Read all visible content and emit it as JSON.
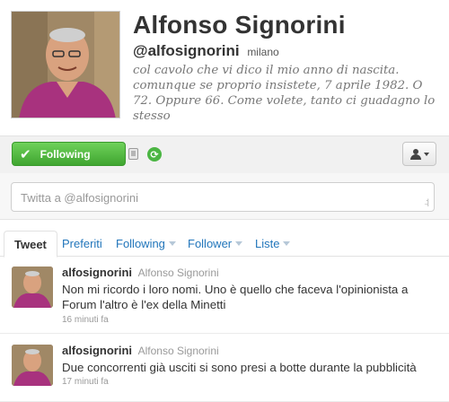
{
  "profile": {
    "display_name": "Alfonso Signorini",
    "screen_name": "@alfosignorini",
    "location": "milano",
    "bio": "col cavolo che vi dico il mio anno di nascita. comunque se proprio insistete, 7 aprile 1982. O 72. Oppure 66. Come volete, tanto ci guadagno lo stesso",
    "avatar_icon": "profile-photo"
  },
  "actions": {
    "following_label": "Following",
    "accent_color": "#4bb543"
  },
  "tweet_box": {
    "placeholder": "Twitta a @alfosignorini"
  },
  "tabs": [
    {
      "label": "Tweet",
      "active": true
    },
    {
      "label": "Preferiti"
    },
    {
      "label": "Following"
    },
    {
      "label": "Follower"
    },
    {
      "label": "Liste"
    }
  ],
  "stream": [
    {
      "screen_name": "alfosignorini",
      "full_name": "Alfonso Signorini",
      "text": "Non mi ricordo i loro nomi. Uno è quello che faceva l'opinionista a Forum l'altro è l'ex della Minetti",
      "time": "16 minuti fa"
    },
    {
      "screen_name": "alfosignorini",
      "full_name": "Alfonso Signorini",
      "text": "Due concorrenti già usciti si sono presi a botte durante la pubblicità",
      "time": "17 minuti fa"
    }
  ],
  "colors": {
    "link": "#2276bb",
    "shirt": "#a8327e"
  }
}
